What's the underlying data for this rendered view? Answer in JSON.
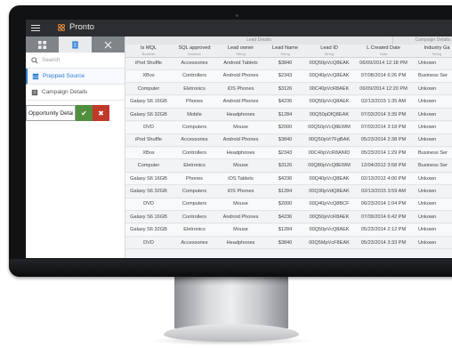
{
  "app": {
    "title": "Pronto"
  },
  "colors": {
    "accent": "#2b7cd3",
    "ok": "#4f8f3d",
    "cancel": "#c0392b",
    "topbar": "#2b2d31",
    "logo": "#e98a3c"
  },
  "sidebar": {
    "tabs": [
      {
        "icon": "grid-icon",
        "active": false
      },
      {
        "icon": "document-icon",
        "active": true
      },
      {
        "icon": "tools-icon",
        "active": false
      }
    ],
    "search_placeholder": "Search",
    "items": [
      {
        "label": "Prepped Source",
        "icon": "database-icon",
        "selected": true
      },
      {
        "label": "Campaign Details",
        "icon": "report-icon",
        "selected": false
      }
    ],
    "edit_value": "Opportunity Details",
    "ok_symbol": "✔",
    "cancel_symbol": "✖"
  },
  "table": {
    "groups": [
      "Lead Details",
      "Campaign Details"
    ],
    "columns": [
      {
        "title": "Is MQL",
        "type": "Boolean"
      },
      {
        "title": "SQL approved",
        "type": "Boolean"
      },
      {
        "title": "Lead owner",
        "type": "String"
      },
      {
        "title": "Lead Name",
        "type": "String"
      },
      {
        "title": "Lead ID",
        "type": "String"
      },
      {
        "title": "L Created Date",
        "type": "Date"
      },
      {
        "title": "Industry Ga",
        "type": "String"
      }
    ],
    "rows": [
      [
        "iPod Shuffle",
        "Accessories",
        "Android Tablets",
        "$3840",
        "00Q50pVcQ8EAK",
        "06/09/2014 12:18 PM",
        "Unkown"
      ],
      [
        "XBox",
        "Controllers",
        "Android Phones",
        "$2343",
        "00Q40pVcQ8EAK",
        "07/08/2014 6:26 PM",
        "Business Ser"
      ],
      [
        "Computer",
        "Eletronics",
        "iOS Phones",
        "$3126",
        "00C40pVcR8AEK",
        "06/09/2014 12:20 PM",
        "Unkown"
      ],
      [
        "Galaxy S6 16GB",
        "Phones",
        "Android Phones",
        "$4236",
        "00Q50pVcQ8AEK",
        "02/13/2015 1:35 AM",
        "Unkown"
      ],
      [
        "Galaxy S6 32GB",
        "Mobile",
        "Headphones",
        "$1284",
        "00Q50pDfQ8EAK",
        "07/03/2014 3:39 PM",
        "Unkown"
      ],
      [
        "DVD",
        "Computers",
        "Mouse",
        "$2000",
        "00Q50pVcQ8EWM",
        "07/03/2014 3:18 PM",
        "Unkown"
      ],
      [
        "iPod Shuffle",
        "Accessories",
        "Android Phones",
        "$3840",
        "00Q50pVr7FgBAK",
        "05/23/2014 2:38 PM",
        "Unkown"
      ],
      [
        "XBox",
        "Controllers",
        "Headphones",
        "$2343",
        "00C40pVcR8ANID",
        "05/23/2014 1:29 PM",
        "Business Ser"
      ],
      [
        "Computer",
        "Eletronics",
        "Mouse",
        "$3126",
        "00Q80pVcQ8EWM",
        "12/04/2012 3:58 PM",
        "Business Ser"
      ],
      [
        "Galaxy S6 16GB",
        "Phones",
        "iOS Tablets",
        "$4236",
        "00Q40pVcQ8EAK",
        "02/13/2012 4:00 PM",
        "Unkown"
      ],
      [
        "Galaxy S6 32GB",
        "Computers",
        "iOS Phones",
        "$1284",
        "00Q30pVdQ8EAK",
        "02/13/2015 3:59 AM",
        "Unkown"
      ],
      [
        "DVD",
        "Computers",
        "Mouse",
        "$2000",
        "00Q40pVcQ8BCF",
        "06/23/2014 1:04 PM",
        "Unkown"
      ],
      [
        "Galaxy S6 16GB",
        "Controllers",
        "Android Phones",
        "$4236",
        "00Q50pVcR8AEK",
        "07/09/2014 6:42 PM",
        "Unkown"
      ],
      [
        "Galaxy S6 32GB",
        "Eletronics",
        "Mouse",
        "$1284",
        "00Q50pVcQ8AEK",
        "05/23/2014 2:12 PM",
        "Unkown"
      ],
      [
        "DVD",
        "Accessories",
        "Headphones",
        "$3840",
        "00Q5MpVcF8EAK",
        "05/23/2014 3:33 PM",
        "Unkown"
      ]
    ]
  }
}
